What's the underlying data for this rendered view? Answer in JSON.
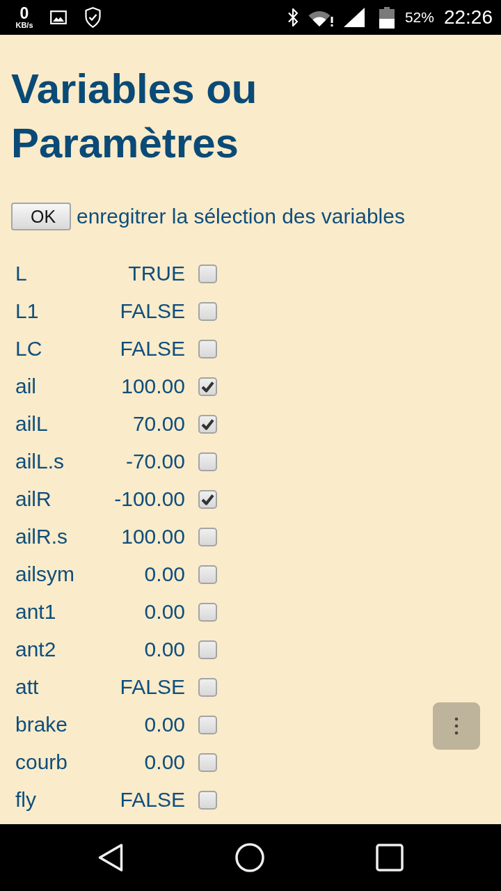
{
  "status_bar": {
    "net_speed": "0",
    "net_speed_unit": "KB/s",
    "battery_percent": "52%",
    "time": "22:26"
  },
  "title": "Variables ou Paramètres",
  "save_selection": {
    "button": "OK",
    "label": "enregitrer la sélection des variables"
  },
  "variables": [
    {
      "name": "L",
      "value": "TRUE",
      "checked": false
    },
    {
      "name": "L1",
      "value": "FALSE",
      "checked": false
    },
    {
      "name": "LC",
      "value": "FALSE",
      "checked": false
    },
    {
      "name": "ail",
      "value": "100.00",
      "checked": true
    },
    {
      "name": "ailL",
      "value": "70.00",
      "checked": true
    },
    {
      "name": "ailL.s",
      "value": "-70.00",
      "checked": false
    },
    {
      "name": "ailR",
      "value": "-100.00",
      "checked": true
    },
    {
      "name": "ailR.s",
      "value": "100.00",
      "checked": false
    },
    {
      "name": "ailsym",
      "value": "0.00",
      "checked": false
    },
    {
      "name": "ant1",
      "value": "0.00",
      "checked": false
    },
    {
      "name": "ant2",
      "value": "0.00",
      "checked": false
    },
    {
      "name": "att",
      "value": "FALSE",
      "checked": false
    },
    {
      "name": "brake",
      "value": "0.00",
      "checked": false
    },
    {
      "name": "courb",
      "value": "0.00",
      "checked": false
    },
    {
      "name": "fly",
      "value": "FALSE",
      "checked": false
    }
  ]
}
